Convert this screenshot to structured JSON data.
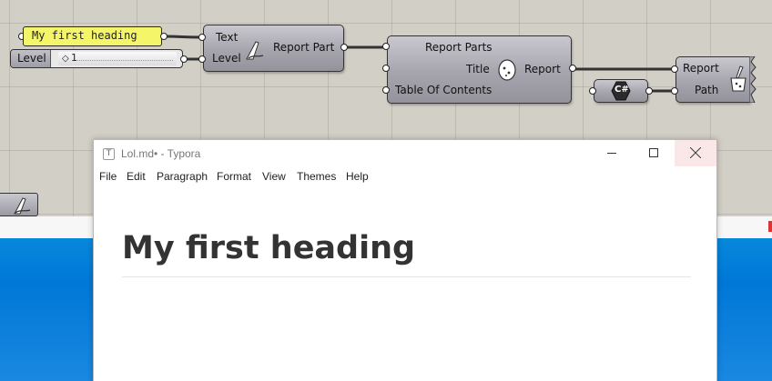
{
  "grasshopper": {
    "panel": {
      "text": "My first heading"
    },
    "slider": {
      "name": "Level",
      "value": "1",
      "knob": "◇"
    },
    "report_part": {
      "inputs": [
        "Text",
        "Level"
      ],
      "output": "Report Part"
    },
    "report": {
      "inputs": [
        "Report Parts",
        "Title",
        "Table Of Contents"
      ],
      "output": "Report"
    },
    "csharp": {
      "label": "C#"
    },
    "file_writer": {
      "inputs": [
        "Report",
        "Path"
      ]
    }
  },
  "typora": {
    "title": "Lol.md• - Typora",
    "app_icon": "T",
    "menu": [
      "File",
      "Edit",
      "Paragraph",
      "Format",
      "View",
      "Themes",
      "Help"
    ],
    "heading": "My first heading"
  },
  "icons": [
    "pen-icon",
    "egg-icon",
    "save-write-icon",
    "csharp-hex-icon",
    "minimize-icon",
    "maximize-icon",
    "close-icon"
  ]
}
